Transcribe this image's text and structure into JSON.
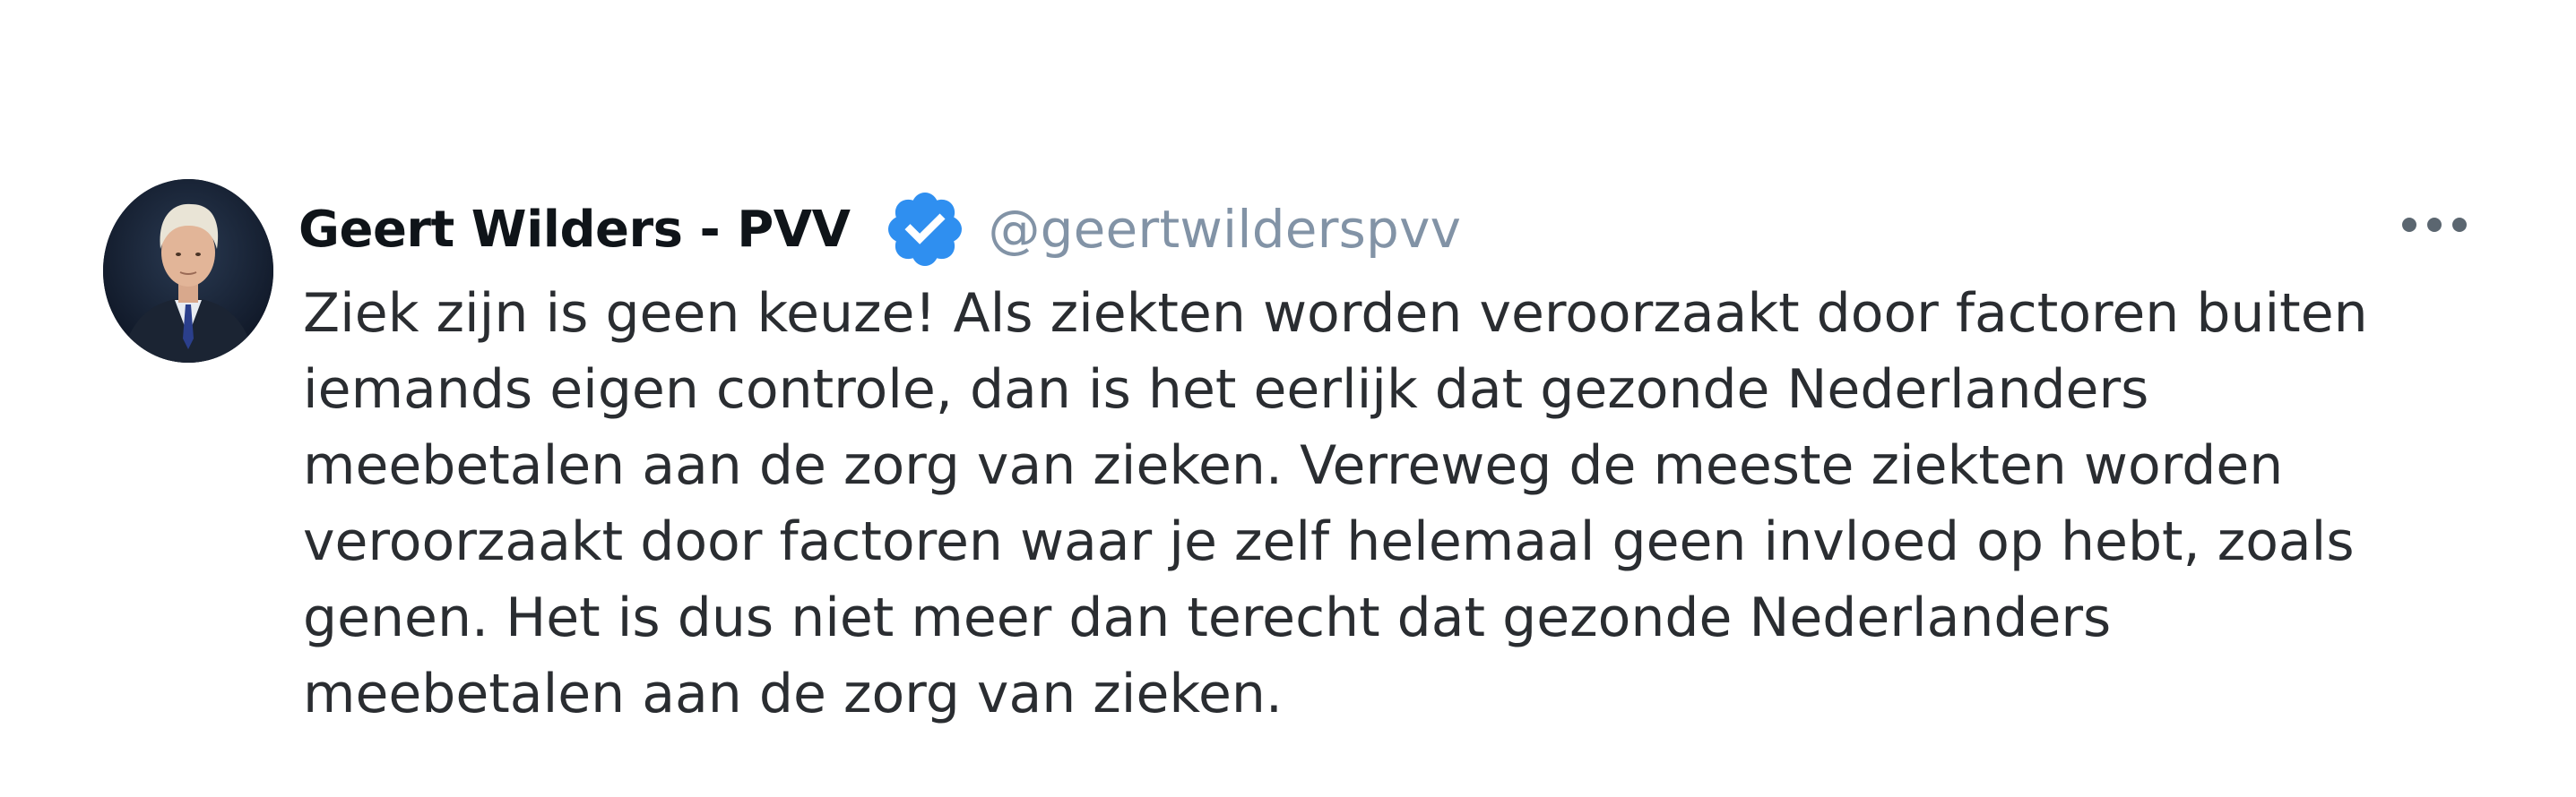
{
  "tweet": {
    "author_name": "Geert Wilders - PVV",
    "handle": "@geertwilderspvv",
    "verified_icon": "verified-badge-icon",
    "more_icon": "more-options-icon",
    "text_lines": [
      "Ziek zijn is geen keuze! Als ziekten worden veroorzaakt door factoren buiten",
      "iemands eigen controle, dan is het eerlijk dat gezonde Nederlanders",
      "meebetalen aan de zorg van zieken. Verreweg de meeste ziekten worden",
      "veroorzaakt door factoren waar je zelf helemaal geen invloed op hebt, zoals",
      "genen. Het is dus niet meer dan terecht dat gezonde Nederlanders",
      "meebetalen aan de zorg van zieken."
    ]
  },
  "colors": {
    "verified_blue": "#2f8ff0",
    "handle_gray": "#8293a6",
    "text_dark": "#2a2d31"
  }
}
